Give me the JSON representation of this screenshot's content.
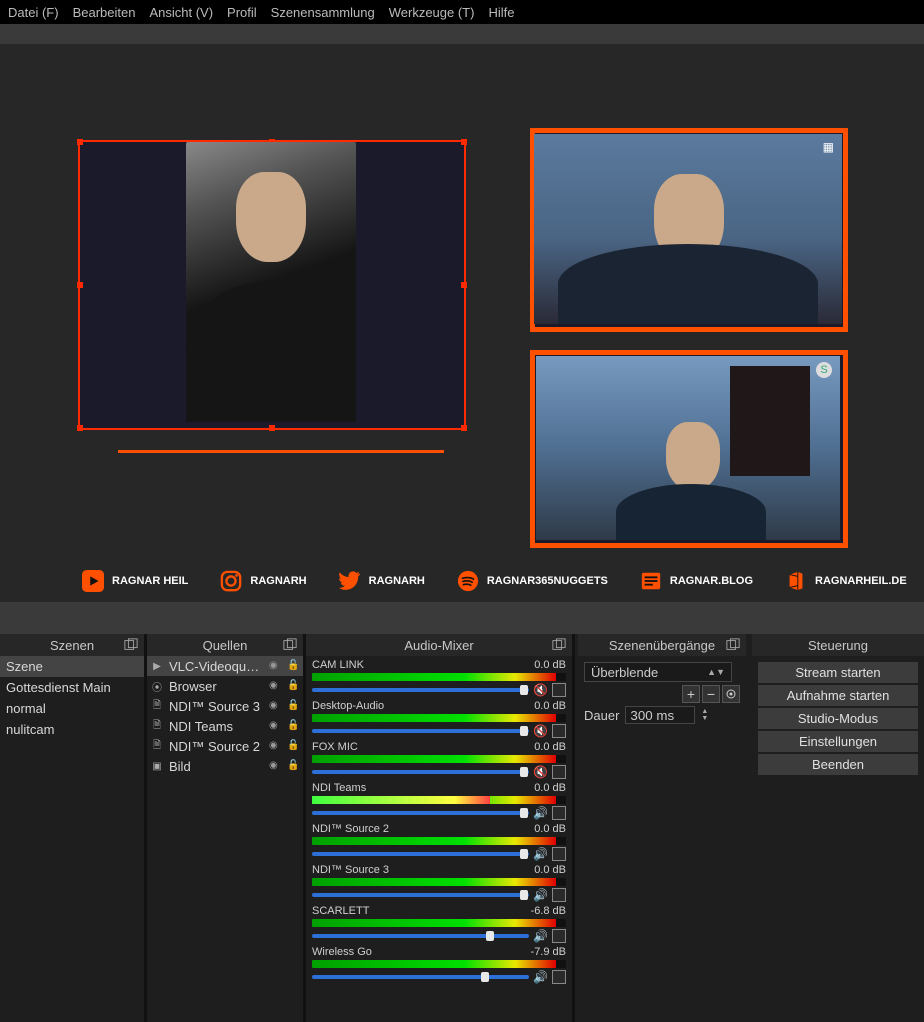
{
  "menu": [
    "Datei (F)",
    "Bearbeiten",
    "Ansicht (V)",
    "Profil",
    "Szenensammlung",
    "Werkzeuge (T)",
    "Hilfe"
  ],
  "social": [
    {
      "icon": "youtube",
      "label": "RAGNAR HEIL"
    },
    {
      "icon": "instagram",
      "label": "RAGNARH"
    },
    {
      "icon": "twitter",
      "label": "RAGNARH"
    },
    {
      "icon": "spotify",
      "label": "RAGNAR365NUGGETS"
    },
    {
      "icon": "blog",
      "label": "RAGNAR.BLOG"
    },
    {
      "icon": "office",
      "label": "RAGNARHEIL.DE"
    }
  ],
  "docks": {
    "scenes_title": "Szenen",
    "sources_title": "Quellen",
    "mixer_title": "Audio-Mixer",
    "transitions_title": "Szenenübergänge",
    "controls_title": "Steuerung"
  },
  "scenes": [
    "Szene",
    "Gottesdienst Main",
    "normal",
    "nulitcam"
  ],
  "scenes_selected": 0,
  "sources": [
    {
      "type": "play",
      "name": "VLC-Videoquelle",
      "sel": true
    },
    {
      "type": "globe",
      "name": "Browser"
    },
    {
      "type": "doc",
      "name": "NDI™ Source 3"
    },
    {
      "type": "doc",
      "name": "NDI Teams"
    },
    {
      "type": "doc",
      "name": "NDI™ Source 2"
    },
    {
      "type": "image",
      "name": "Bild"
    }
  ],
  "mixer": [
    {
      "name": "CAM LINK",
      "db": "0.0 dB",
      "muted": true,
      "thumb": 96
    },
    {
      "name": "Desktop-Audio",
      "db": "0.0 dB",
      "muted": true,
      "thumb": 96
    },
    {
      "name": "FOX MIC",
      "db": "0.0 dB",
      "muted": true,
      "thumb": 96
    },
    {
      "name": "NDI Teams",
      "db": "0.0 dB",
      "muted": false,
      "thumb": 96,
      "active": true
    },
    {
      "name": "NDI™ Source 2",
      "db": "0.0 dB",
      "muted": false,
      "thumb": 96
    },
    {
      "name": "NDI™ Source 3",
      "db": "0.0 dB",
      "muted": false,
      "thumb": 96
    },
    {
      "name": "SCARLETT",
      "db": "-6.8 dB",
      "muted": false,
      "thumb": 80
    },
    {
      "name": "Wireless Go",
      "db": "-7.9 dB",
      "muted": false,
      "thumb": 78
    }
  ],
  "transitions": {
    "selected": "Überblende",
    "duration_label": "Dauer",
    "duration_value": "300 ms"
  },
  "controls": [
    "Stream starten",
    "Aufnahme starten",
    "Studio-Modus",
    "Einstellungen",
    "Beenden"
  ]
}
